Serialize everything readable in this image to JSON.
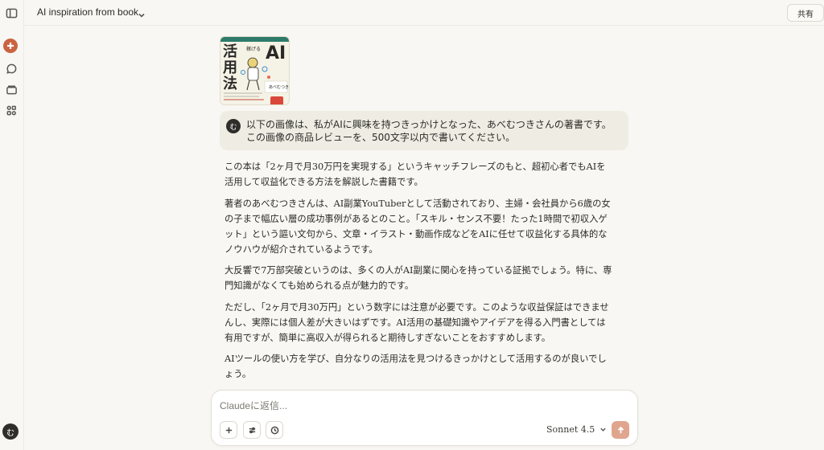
{
  "header": {
    "title": "AI inspiration from book",
    "share_label": "共有"
  },
  "sidebar": {
    "items": [
      {
        "icon": "sidebar-toggle-icon"
      },
      {
        "icon": "plus-icon"
      },
      {
        "icon": "chat-icon"
      },
      {
        "icon": "projects-icon"
      },
      {
        "icon": "artifacts-icon"
      }
    ],
    "user_initial": "む"
  },
  "book": {
    "cover_title": "活用法",
    "cover_letters": "AI",
    "cover_small": "稼げる",
    "cover_author": "あべむつき"
  },
  "user_message": {
    "avatar": "む",
    "text": "以下の画像は、私がAIに興味を持つきっかけとなった、あべむつきさんの著書です。この画像の商品レビューを、500文字以内で書いてください。"
  },
  "response": {
    "paragraphs": [
      "この本は「2ヶ月で月30万円を実現する」というキャッチフレーズのもと、超初心者でもAIを活用して収益化できる方法を解説した書籍です。",
      "著者のあべむつきさんは、AI副業YouTuberとして活動されており、主婦・会社員から6歳の女の子まで幅広い層の成功事例があるとのこと。「スキル・センス不要！たった1時間で初収入ゲット」という謳い文句から、文章・イラスト・動画作成などをAIに任せて収益化する具体的なノウハウが紹介されているようです。",
      "大反響で7万部突破というのは、多くの人がAI副業に関心を持っている証拠でしょう。特に、専門知識がなくても始められる点が魅力的です。",
      "ただし、「2ヶ月で月30万円」という数字には注意が必要です。このような収益保証はできませんし、実際には個人差が大きいはずです。AI活用の基礎知識やアイデアを得る入門書としては有用ですが、簡単に高収入が得られると期待しすぎないことをおすすめします。",
      "AIツールの使い方を学び、自分なりの活用法を見つけるきっかけとして活用するのが良いでしょう。"
    ]
  },
  "composer": {
    "placeholder": "Claudeに返信...",
    "value": "",
    "model": "Sonnet 4.5"
  },
  "colors": {
    "accent": "#c96442",
    "send": "#e0a58e",
    "bubble": "#efece3",
    "background": "#f8f7f3"
  }
}
